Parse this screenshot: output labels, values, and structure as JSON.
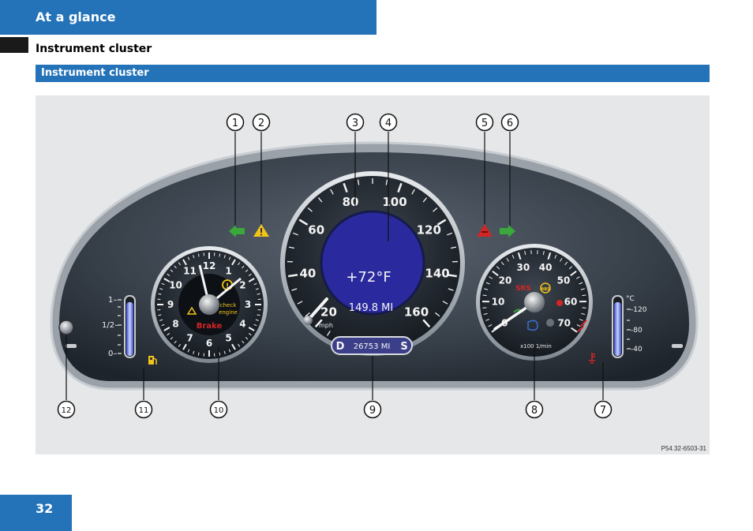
{
  "header": {
    "title": "At a glance"
  },
  "subheading": "Instrument cluster",
  "section": {
    "title": "Instrument cluster"
  },
  "figure": {
    "callouts": [
      "1",
      "2",
      "3",
      "4",
      "5",
      "6",
      "7",
      "8",
      "9",
      "10",
      "11",
      "12"
    ],
    "speedometer": {
      "labels": [
        "20",
        "40",
        "60",
        "80",
        "100",
        "120",
        "140",
        "160"
      ],
      "unit": "mph",
      "temperature": "+72°F",
      "trip": "149.8 MI",
      "odometer": "26753 MI",
      "gear": "D",
      "mode": "S"
    },
    "clock": {
      "labels": [
        "12",
        "1",
        "2",
        "3",
        "4",
        "5",
        "6",
        "7",
        "8",
        "9",
        "10",
        "11"
      ],
      "check": "check",
      "engine": "engine",
      "brake": "Brake"
    },
    "tachometer": {
      "labels": [
        "0",
        "10",
        "20",
        "30",
        "40",
        "50",
        "60",
        "70"
      ],
      "unit": "x100 1/min",
      "srs": "SRS"
    },
    "fuel": {
      "labels": [
        "1–",
        "1/2–",
        "0–"
      ]
    },
    "coolant": {
      "unit": "°C",
      "labels": [
        "-120",
        "-80",
        "-40"
      ]
    },
    "reference": "P54.32-6503-31"
  },
  "colors": {
    "brand": "#2473b8",
    "turn_signal": "#3aa83a",
    "warning": "#f2c419",
    "hazard": "#d42525",
    "display": "#2a2a9e"
  },
  "page_number": "32"
}
